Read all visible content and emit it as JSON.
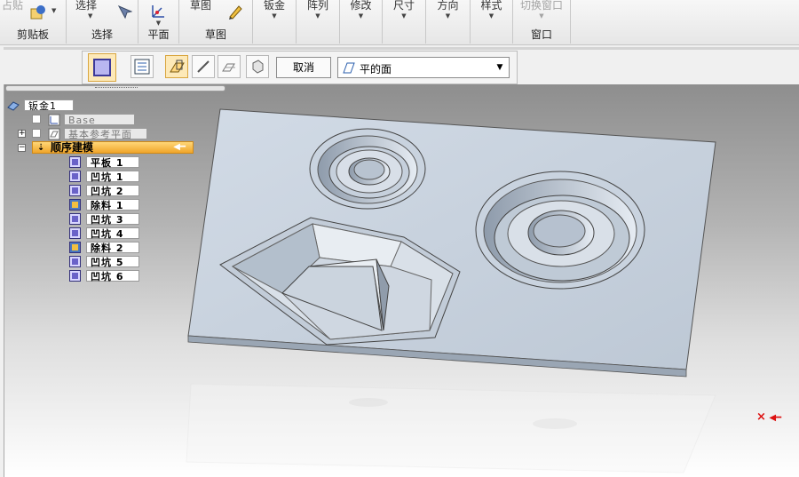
{
  "ribbon": {
    "groups": [
      {
        "top": "占贴",
        "bottom": "剪贴板"
      },
      {
        "top": "选择",
        "bottom": "选择"
      },
      {
        "top": "",
        "bottom": "平面"
      },
      {
        "top": "草图",
        "bottom": "草图"
      },
      {
        "top": "钣金",
        "bottom": ""
      },
      {
        "top": "阵列",
        "bottom": ""
      },
      {
        "top": "修改",
        "bottom": ""
      },
      {
        "top": "尺寸",
        "bottom": ""
      },
      {
        "top": "方向",
        "bottom": ""
      },
      {
        "top": "样式",
        "bottom": ""
      },
      {
        "top": "切换窗口",
        "bottom": "窗口"
      }
    ]
  },
  "command_bar": {
    "cancel_label": "取消",
    "face_select_value": "平的面"
  },
  "tree": {
    "root": "钣金1",
    "base": "Base",
    "ref_planes": "基本参考平面",
    "sequential": "顺序建模",
    "features": [
      {
        "label": "平板 1",
        "icon": "tab-icon"
      },
      {
        "label": "凹坑 1",
        "icon": "dimple-icon"
      },
      {
        "label": "凹坑 2",
        "icon": "dimple-icon"
      },
      {
        "label": "除料 1",
        "icon": "cutout-icon"
      },
      {
        "label": "凹坑 3",
        "icon": "dimple-icon"
      },
      {
        "label": "凹坑 4",
        "icon": "dimple-icon"
      },
      {
        "label": "除料 2",
        "icon": "cutout-icon"
      },
      {
        "label": "凹坑 5",
        "icon": "dimple-icon"
      },
      {
        "label": "凹坑 6",
        "icon": "dimple-icon"
      }
    ]
  },
  "viewport": {
    "marker": "×"
  },
  "colors": {
    "plate": "#c4cfdb",
    "accent": "#f0a52a"
  }
}
